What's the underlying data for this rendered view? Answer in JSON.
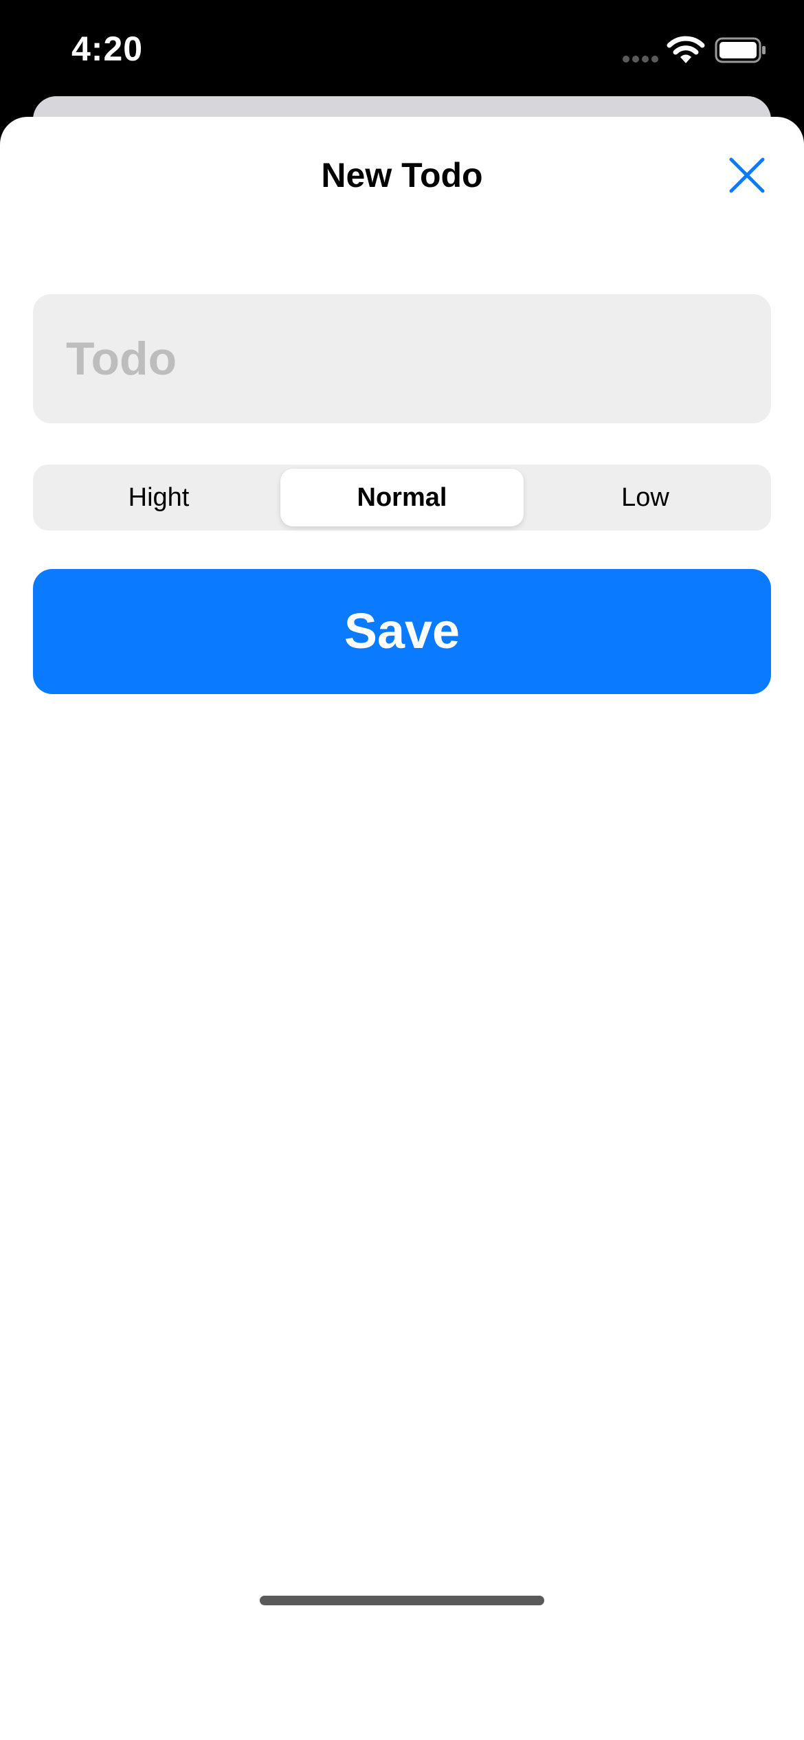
{
  "status_bar": {
    "time": "4:20",
    "icons": [
      "signal-dots-icon",
      "wifi-icon",
      "battery-icon"
    ]
  },
  "sheet": {
    "title": "New Todo",
    "close_icon": "close-icon"
  },
  "form": {
    "todo_placeholder": "Todo",
    "todo_value": "",
    "priority_segments": [
      "Hight",
      "Normal",
      "Low"
    ],
    "priority_selected": "Normal",
    "save_label": "Save"
  },
  "colors": {
    "accent": "#0a7aff",
    "field_background": "#eeeeee",
    "placeholder": "#bdbdbd"
  }
}
